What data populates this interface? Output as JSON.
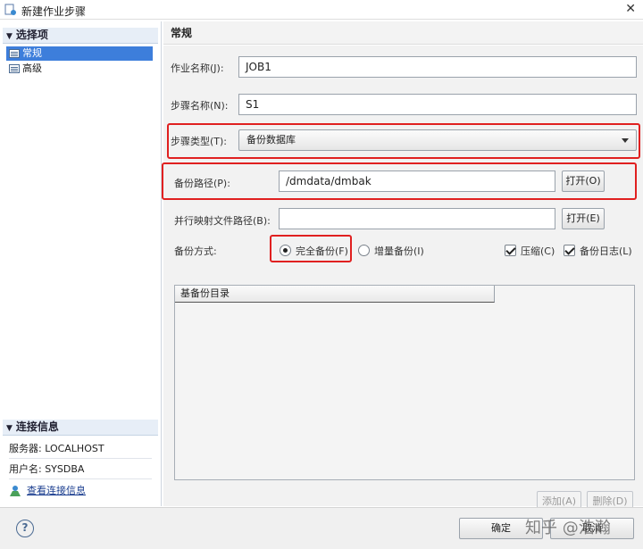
{
  "window": {
    "title": "新建作业步骤",
    "close_glyph": "✕"
  },
  "nav": {
    "select_header": "选择项",
    "items": [
      {
        "label": "常规",
        "selected": true
      },
      {
        "label": "高级",
        "selected": false
      }
    ],
    "conn_header": "连接信息",
    "server": "服务器: LOCALHOST",
    "user": "用户名: SYSDBA",
    "view_conn_link": "查看连接信息"
  },
  "panel": {
    "title": "常规",
    "job_name_label": "作业名称(J):",
    "job_name_value": "JOB1",
    "step_name_label": "步骤名称(N):",
    "step_name_value": "S1",
    "step_type_label": "步骤类型(T):",
    "step_type_value": "备份数据库",
    "backup_path_label": "备份路径(P):",
    "backup_path_value": "/dmdata/dmbak",
    "open_btn_1": "打开(O)",
    "parallel_map_label": "并行映射文件路径(B):",
    "parallel_map_value": "",
    "open_btn_2": "打开(E)",
    "backup_mode_label": "备份方式:",
    "full_backup": "完全备份(F)",
    "incremental_backup": "增量备份(I)",
    "compress": "压缩(C)",
    "backup_log": "备份日志(L)",
    "base_dir_header": "基备份目录",
    "add_btn": "添加(A)",
    "delete_btn": "删除(D)"
  },
  "bottom": {
    "help": "?",
    "ok_btn": "确定",
    "cancel_btn": "取消",
    "watermark": "知乎 @浩瀚"
  },
  "colors": {
    "highlight_border": "#e02020",
    "selection_bg": "#3d7edb"
  },
  "icons": [
    "app-icon",
    "close-icon",
    "collapse-arrow-icon",
    "list-icon",
    "connection-icon",
    "dropdown-arrow-icon",
    "help-icon"
  ]
}
